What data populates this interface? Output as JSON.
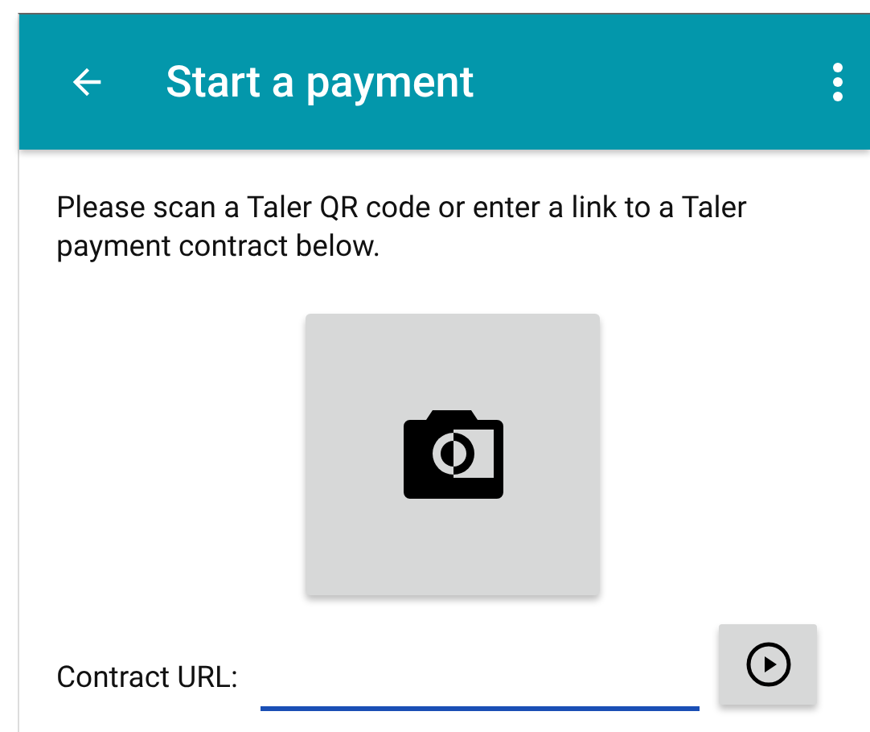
{
  "app_bar": {
    "title": "Start a payment"
  },
  "instructions": "Please scan a Taler QR code or enter a link to a Taler payment contract below.",
  "contract_url": {
    "label": "Contract URL:",
    "focused": true
  }
}
